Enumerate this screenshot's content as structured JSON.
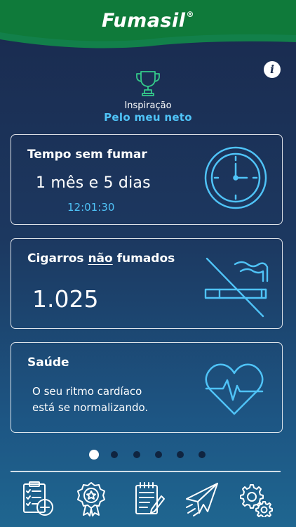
{
  "header": {
    "brand": "Fumasil",
    "brand_mark": "®",
    "info_label": "i"
  },
  "inspiration": {
    "label": "Inspiração",
    "value": "Pelo meu neto",
    "icon": "trophy-icon"
  },
  "cards": {
    "time": {
      "title": "Tempo sem fumar",
      "elapsed": "1 mês e 5 dias",
      "clock": "12:01:30",
      "icon": "clock-icon"
    },
    "cigarettes": {
      "title_before": "Cigarros ",
      "title_underlined": "não",
      "title_after": " fumados",
      "count": "1.025",
      "icon": "no-smoking-icon"
    },
    "health": {
      "title": "Saúde",
      "line1": "O seu ritmo cardíaco",
      "line2": "está se normalizando.",
      "icon": "heartbeat-icon"
    }
  },
  "pagination": {
    "total": 6,
    "current": 1
  },
  "tabbar": [
    "checklist-icon",
    "award-badge-icon",
    "notepad-icon",
    "paper-plane-icon",
    "settings-gears-icon"
  ],
  "colors": {
    "accent": "#4fc3f7",
    "brand_green": "#0f7a3a",
    "background_top": "#1a2a4e",
    "background_bottom": "#1f6690"
  }
}
